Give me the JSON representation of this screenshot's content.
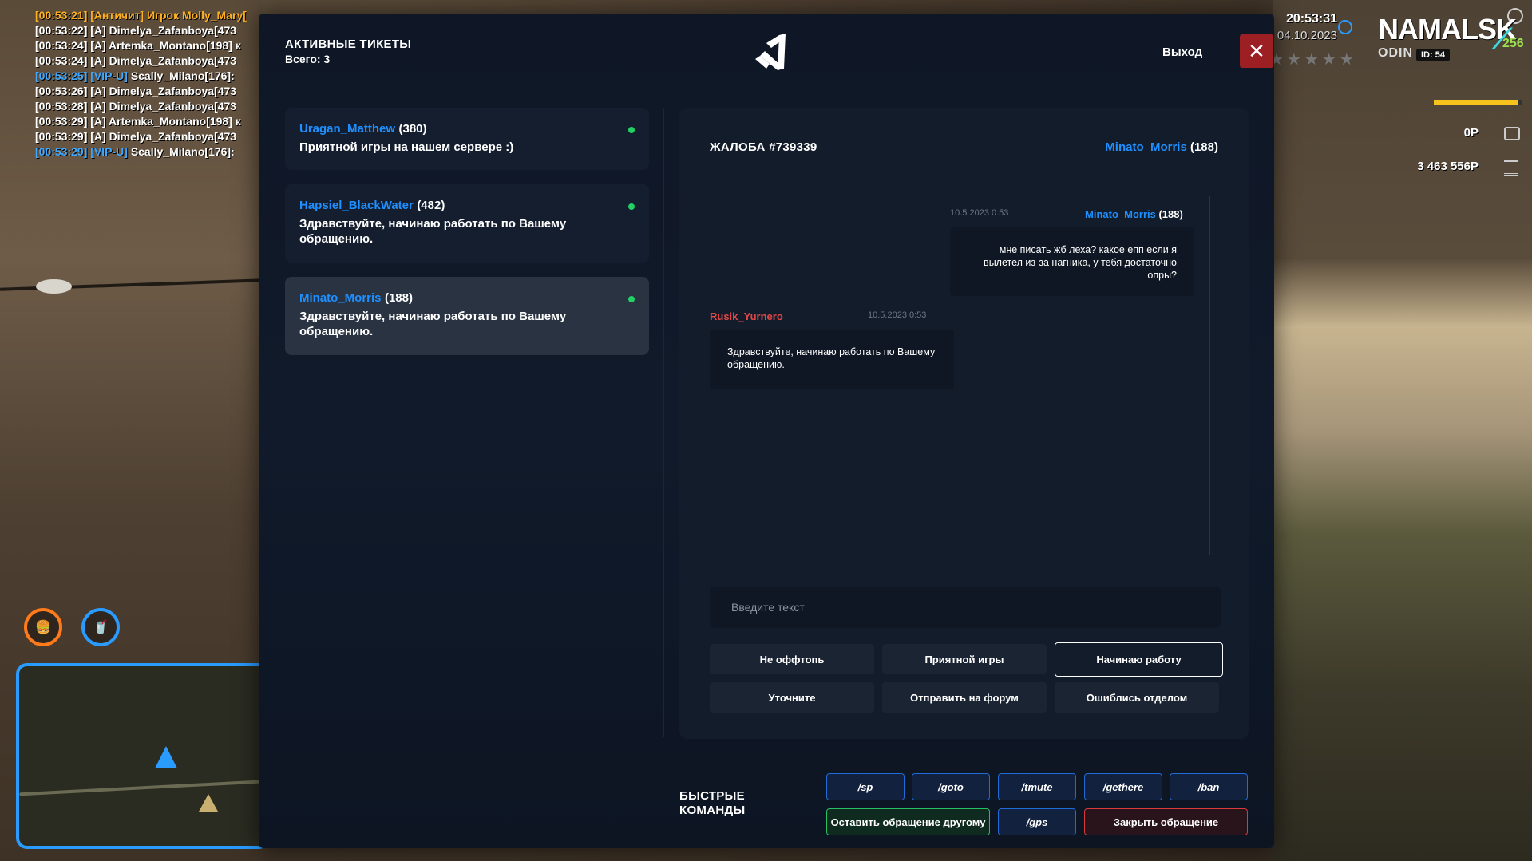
{
  "chat_log": [
    {
      "parts": [
        {
          "t": "[00:53:21] [Античит] Игрок Molly_Mary[",
          "c": "orange"
        }
      ]
    },
    {
      "parts": [
        {
          "t": "[00:53:22] [A] Dimelya_Zafanboya[473",
          "c": "white"
        }
      ]
    },
    {
      "parts": [
        {
          "t": "[00:53:24] [A] Artemka_Montano[198] к",
          "c": "white"
        }
      ]
    },
    {
      "parts": [
        {
          "t": "[00:53:24] [A] Dimelya_Zafanboya[473",
          "c": "white"
        }
      ]
    },
    {
      "parts": [
        {
          "t": "[00:53:25] [VIP-U] ",
          "c": "blue"
        },
        {
          "t": "Scally_Milano[176]:",
          "c": "white"
        }
      ]
    },
    {
      "parts": [
        {
          "t": "[00:53:26] [A] Dimelya_Zafanboya[473",
          "c": "white"
        }
      ]
    },
    {
      "parts": [
        {
          "t": "[00:53:28] [A] Dimelya_Zafanboya[473",
          "c": "white"
        }
      ]
    },
    {
      "parts": [
        {
          "t": "[00:53:29] [A] Artemka_Montano[198] к",
          "c": "white"
        }
      ]
    },
    {
      "parts": [
        {
          "t": "[00:53:29] [A] Dimelya_Zafanboya[473",
          "c": "white"
        }
      ]
    },
    {
      "parts": [
        {
          "t": "[00:53:29] [VIP-U] ",
          "c": "blue"
        },
        {
          "t": "Scally_Milano[176]:",
          "c": "white"
        }
      ]
    }
  ],
  "hud": {
    "time": "20:53:31",
    "date": "04.10.2023",
    "stars": "★★★★★",
    "server_name": "NAMALSK",
    "server_sub": "ODIN",
    "id_label": "ID: 54",
    "badge_num": "256",
    "hp_fraction": 0.95,
    "cash": "0Р",
    "bank": "3 463 556Р",
    "food_icon": "burger-icon",
    "drink_icon": "cup-icon"
  },
  "panel": {
    "title": "АКТИВНЫЕ ТИКЕТЫ",
    "total": "Всего: 3",
    "exit_label": "Выход",
    "exit_symbol": "✕"
  },
  "tickets": [
    {
      "name": "Uragan_Matthew",
      "num": "(380)",
      "msg": "Приятной игры на нашем сервере :)"
    },
    {
      "name": "Hapsiel_BlackWater",
      "num": "(482)",
      "msg": "Здравствуйте, начинаю работать по Вашему обращению."
    },
    {
      "name": "Minato_Morris",
      "num": "(188)",
      "msg": "Здравствуйте, начинаю работать по Вашему обращению."
    }
  ],
  "complaint": {
    "title": "ЖАЛОБА #739339",
    "user_name": "Minato_Morris",
    "user_num": "(188)",
    "messages": {
      "incoming": {
        "time": "10.5.2023 0:53",
        "author": "Minato_Morris",
        "author_num": "(188)",
        "text": "мне писать жб леха? какое епп если я вылетел из-за нагника, у тебя достаточно опры?"
      },
      "outgoing": {
        "author": "Rusik_Yurnero",
        "time": "10.5.2023 0:53",
        "text": "Здравствуйте, начинаю работать по Вашему обращению."
      }
    },
    "input_placeholder": "Введите текст",
    "quick": [
      "Не оффтопь",
      "Приятной игры",
      "Начинаю работу",
      "Уточните",
      "Отправить на форум",
      "Ошиблись отделом"
    ]
  },
  "fast": {
    "title_line1": "БЫСТРЫЕ",
    "title_line2": "КОМАНДЫ",
    "cmds": [
      "/sp",
      "/goto",
      "/tmute",
      "/gethere",
      "/ban"
    ],
    "leave": "Оставить обращение другому",
    "gps": "/gps",
    "close": "Закрыть обращение"
  }
}
